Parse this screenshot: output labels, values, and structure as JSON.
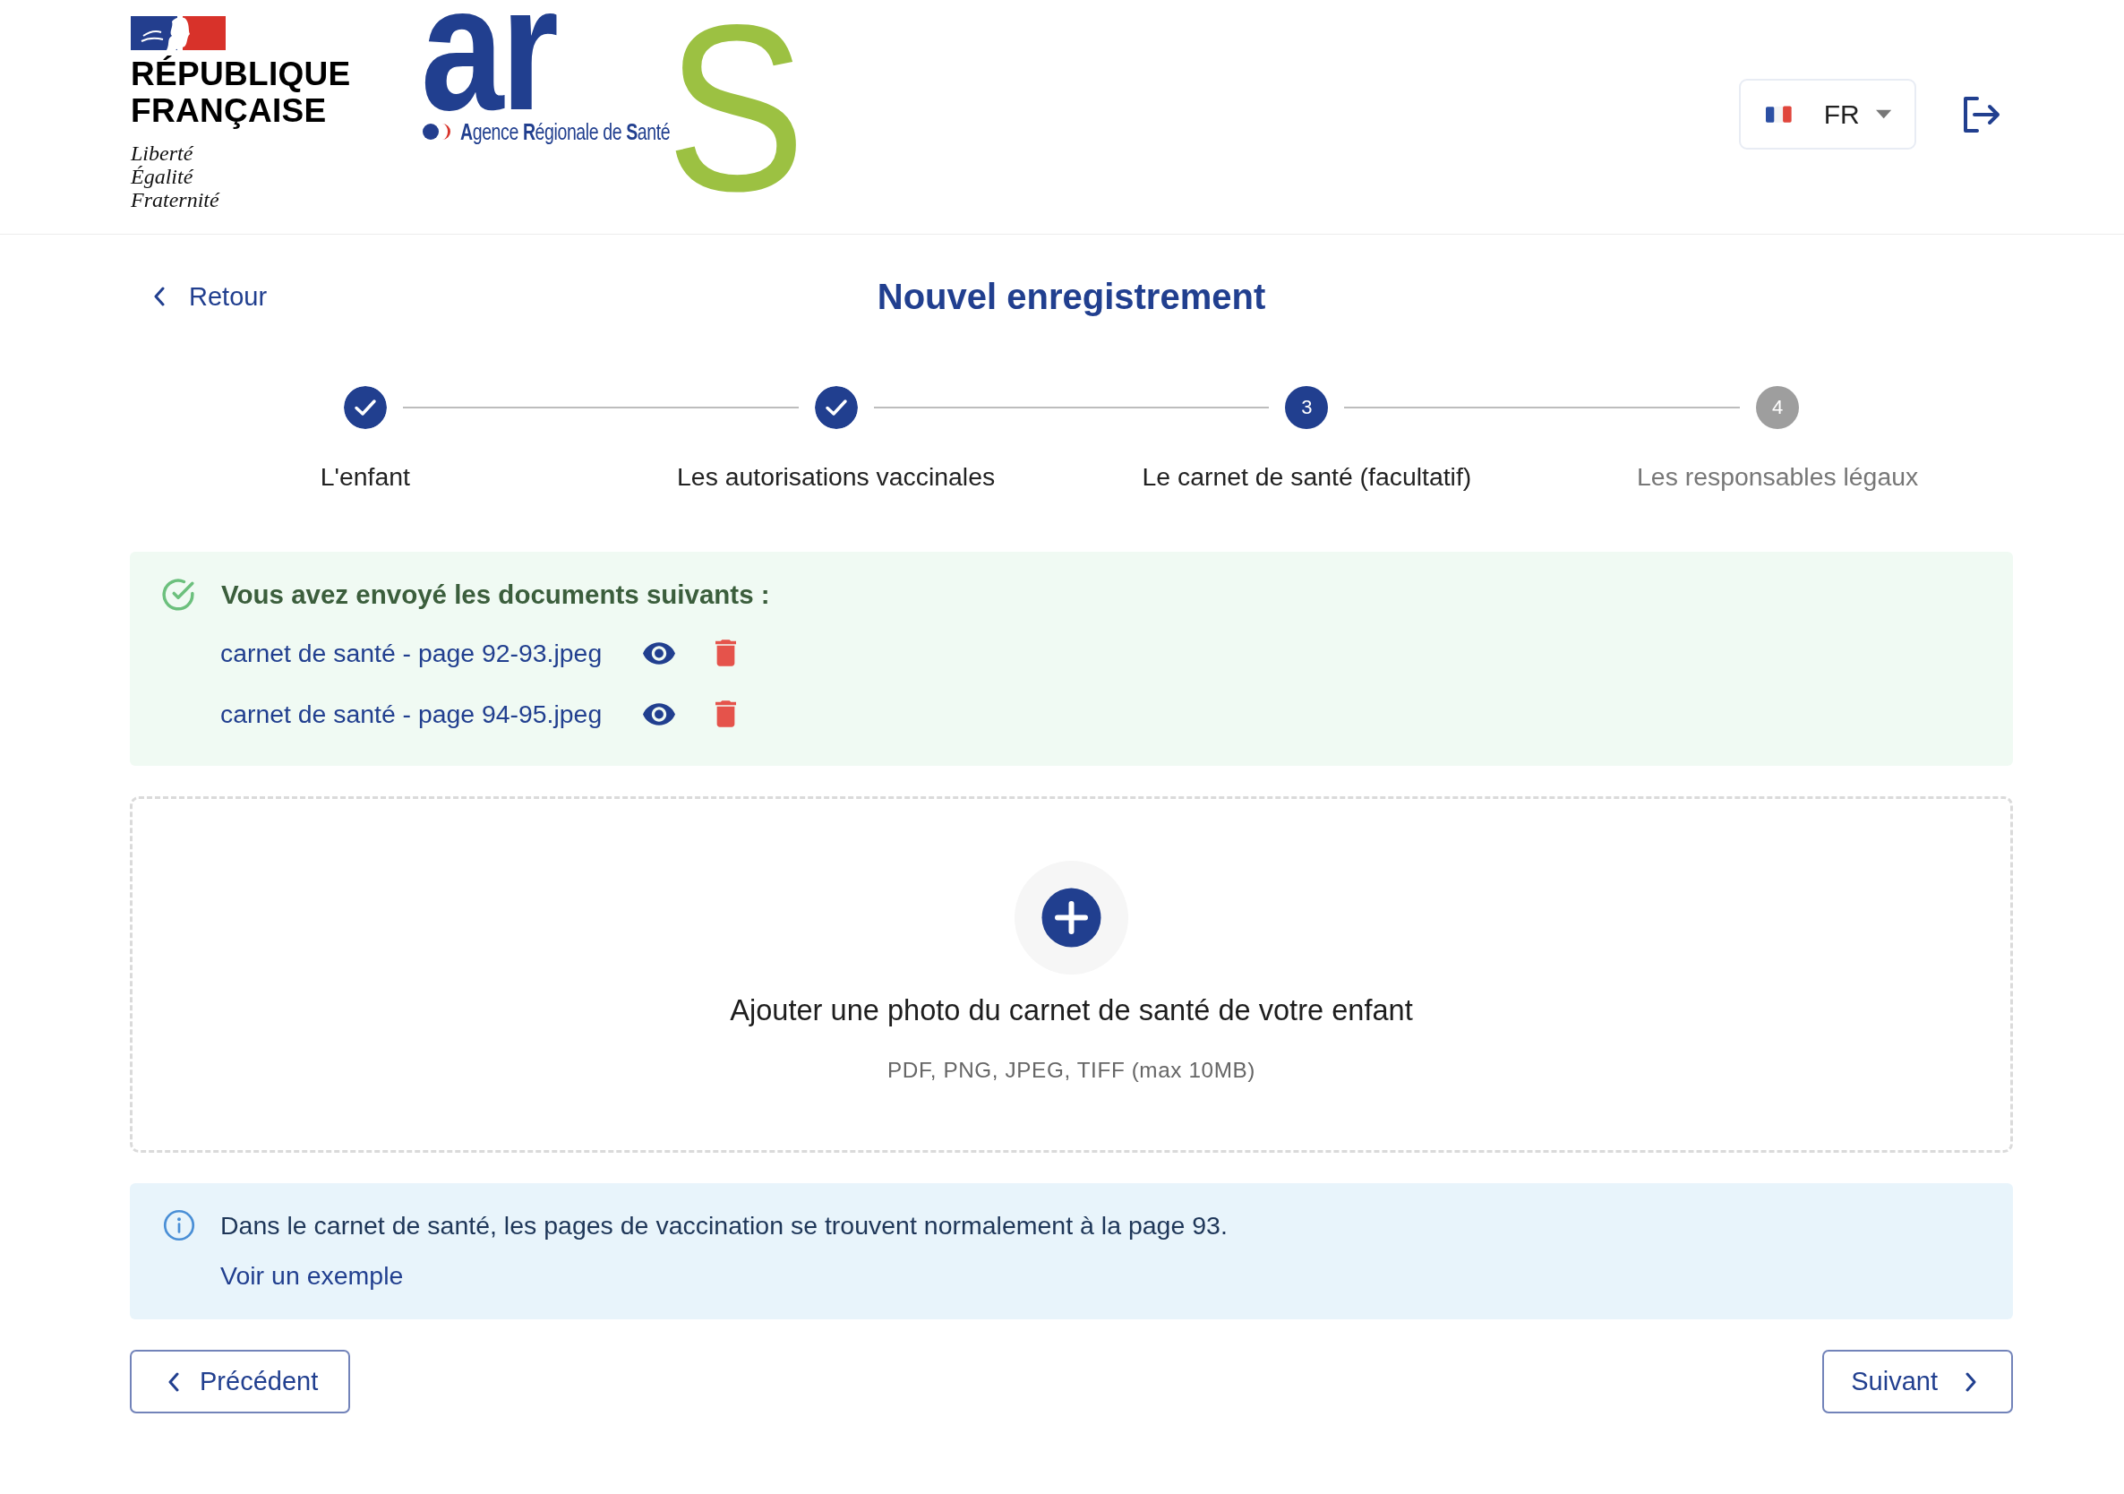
{
  "header": {
    "republic_logo": {
      "lines": [
        "RÉPUBLIQUE",
        "FRANÇAISE"
      ],
      "motto": [
        "Liberté",
        "Égalité",
        "Fraternité"
      ]
    },
    "agency_logo": {
      "letters": "ar",
      "last_letter": "S",
      "name": "**A**gence **R**égionale de **S**anté"
    },
    "language_select": {
      "value": "FR"
    }
  },
  "back_link": "Retour",
  "title": "Nouvel enregistrement",
  "steps": [
    {
      "label": "L'enfant",
      "completed": true,
      "selected": false
    },
    {
      "label": "Les autorisations vaccinales",
      "completed": true,
      "selected": false
    },
    {
      "label": "Le carnet de santé (facultatif)",
      "number": "3",
      "completed": false,
      "selected": true
    },
    {
      "label": "Les responsables légaux",
      "number": "4",
      "completed": false,
      "selected": false
    }
  ],
  "uploaded_files": {
    "heading": "Vous avez envoyé les documents suivants :",
    "files": [
      {
        "name": "carnet de santé - page 92-93.jpeg"
      },
      {
        "name": "carnet de santé - page 94-95.jpeg"
      }
    ]
  },
  "dropzone": {
    "label": "Ajouter une photo du carnet de santé de votre enfant",
    "hint": "PDF, PNG, JPEG, TIFF (max 10MB)"
  },
  "info": {
    "text": "Dans le carnet de santé, les pages de vaccination se trouvent normalement à la page 93.",
    "link": "Voir un exemple"
  },
  "navigation": {
    "previous": "Précédent",
    "next": "Suivant"
  }
}
